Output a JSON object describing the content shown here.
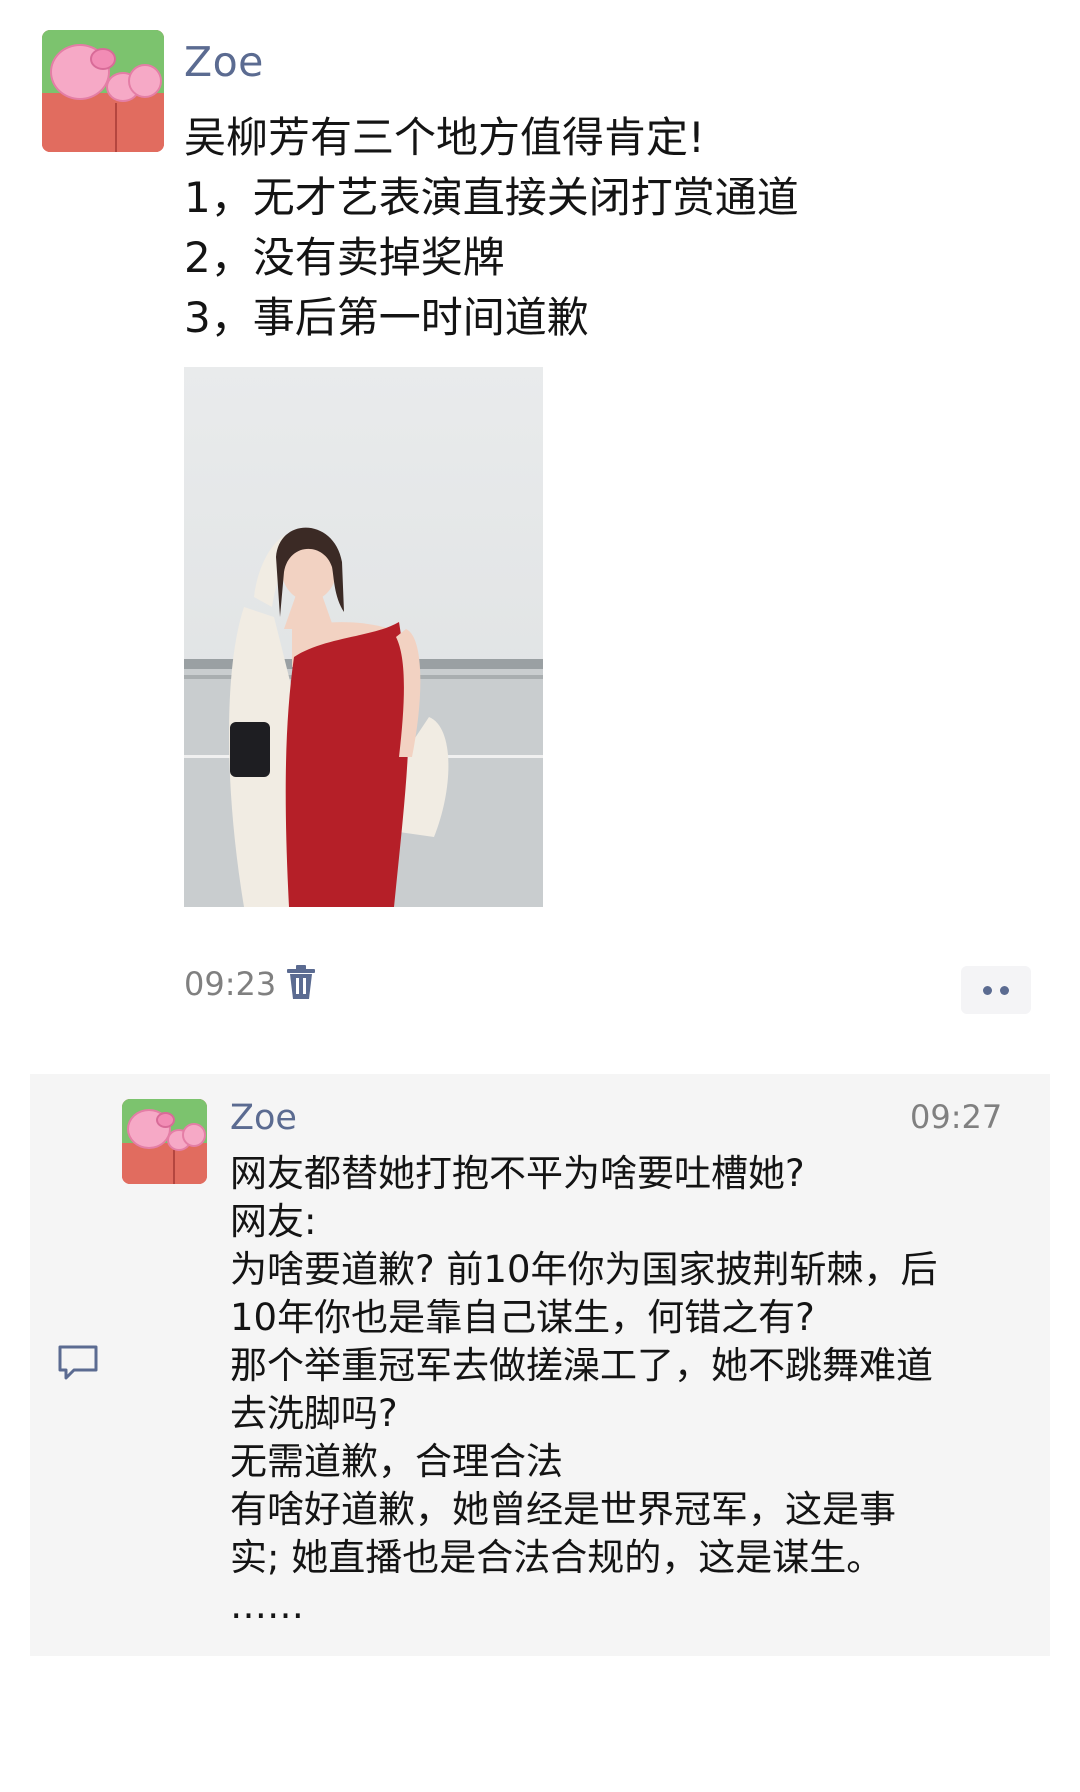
{
  "post": {
    "author": "Zoe",
    "lines": [
      "吴柳芳有三个地方值得肯定!",
      "1，无才艺表演直接关闭打赏通道",
      "2，没有卖掉奖牌",
      "3，事后第一时间道歉"
    ],
    "time": "09:23"
  },
  "comment": {
    "author": "Zoe",
    "time": "09:27",
    "lines": [
      "网友都替她打抱不平为啥要吐槽她?",
      "网友:",
      "为啥要道歉? 前10年你为国家披荆斩棘，后",
      "10年你也是靠自己谋生，何错之有?",
      "那个举重冠军去做搓澡工了，她不跳舞难道",
      "去洗脚吗?",
      "无需道歉，合理合法",
      "有啥好道歉，她曾经是世界冠军，这是事",
      "实; 她直播也是合法合规的，这是谋生。",
      "……"
    ]
  },
  "colors": {
    "name": "#5b6b91",
    "timestamp": "#808080",
    "comment_bg": "#f5f5f5"
  },
  "icons": [
    "avatar-pig",
    "trash-icon",
    "more-icon",
    "comment-icon"
  ]
}
